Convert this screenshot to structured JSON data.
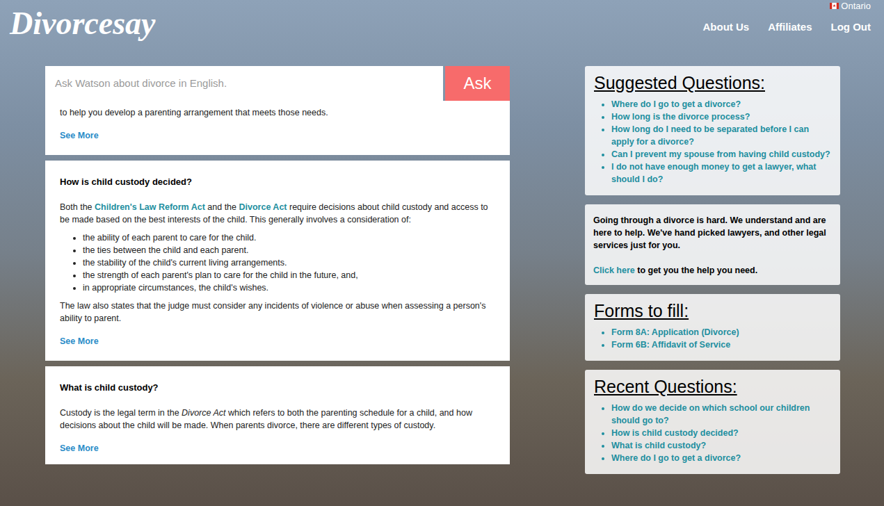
{
  "header": {
    "logo": "Divorcesay",
    "region": "Ontario",
    "nav": [
      "About Us",
      "Affiliates",
      "Log Out"
    ]
  },
  "search": {
    "placeholder": "Ask Watson about divorce in English.",
    "button": "Ask"
  },
  "answers": [
    {
      "title": "",
      "paragraphs": [
        [
          {
            "kind": "text",
            "text": "to help you develop a parenting arrangement that meets those needs."
          }
        ]
      ],
      "bullets": [],
      "after": [],
      "more": "See More"
    },
    {
      "title": "How is child custody decided?",
      "paragraphs": [
        [
          {
            "kind": "text",
            "text": "Both the "
          },
          {
            "kind": "link",
            "text": "Children's Law Reform Act"
          },
          {
            "kind": "text",
            "text": " and the "
          },
          {
            "kind": "link",
            "text": "Divorce Act"
          },
          {
            "kind": "text",
            "text": " require decisions about child custody and access to be made based on the best interests of the child. This generally involves a consideration of:"
          }
        ]
      ],
      "bullets": [
        "the ability of each parent to care for the child.",
        "the ties between the child and each parent.",
        "the stability of the child's current living arrangements.",
        "the strength of each parent's plan to care for the child in the future, and,",
        "in appropriate circumstances, the child's wishes."
      ],
      "after": [
        [
          {
            "kind": "text",
            "text": "The law also states that the judge must consider any incidents of violence or abuse when assessing a person's ability to parent."
          }
        ]
      ],
      "more": "See More"
    },
    {
      "title": "What is child custody?",
      "paragraphs": [
        [
          {
            "kind": "text",
            "text": "Custody is the legal term in the "
          },
          {
            "kind": "italic",
            "text": "Divorce Act"
          },
          {
            "kind": "text",
            "text": " which refers to both the parenting schedule for a child, and how decisions about the child will be made. When parents divorce, there are different types of custody."
          }
        ]
      ],
      "bullets": [],
      "after": [],
      "more": "See More"
    }
  ],
  "sidebar": {
    "suggested": {
      "title": "Suggested Questions:",
      "items": [
        "Where do I go to get a divorce?",
        "How long is the divorce process?",
        "How long do I need to be separated before I can apply for a divorce?",
        "Can I prevent my spouse from having child custody?",
        "I do not have enough money to get a lawyer, what should I do?"
      ]
    },
    "help": {
      "text": "Going through a divorce is hard. We understand and are here to help. We've hand picked lawyers, and other legal services just for you.",
      "link": "Click here",
      "rest": " to get you the help you need."
    },
    "forms": {
      "title": "Forms to fill:",
      "items": [
        "Form 8A: Application (Divorce)",
        "Form 6B: Affidavit of Service"
      ]
    },
    "recent": {
      "title": "Recent Questions:",
      "items": [
        "How do we decide on which school our children should go to?",
        "How is child custody decided?",
        "What is child custody?",
        "Where do I go to get a divorce?"
      ]
    }
  }
}
